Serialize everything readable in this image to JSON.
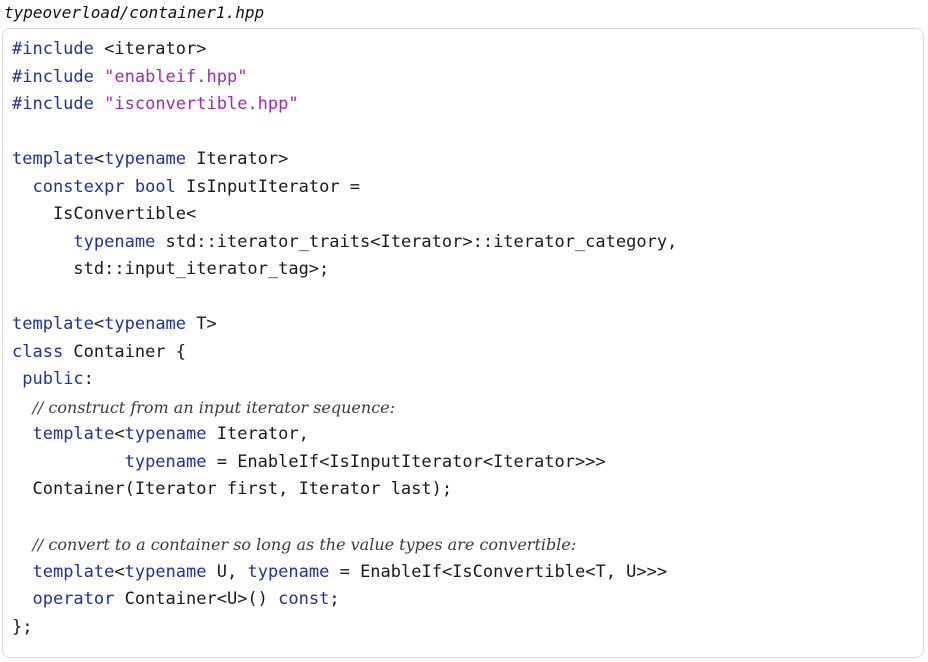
{
  "file": {
    "name": "typeoverload/container1.hpp"
  },
  "code": {
    "lines": [
      [
        {
          "t": "pp",
          "v": "#include"
        },
        {
          "t": "plain",
          "v": " <iterator>"
        }
      ],
      [
        {
          "t": "pp",
          "v": "#include"
        },
        {
          "t": "plain",
          "v": " "
        },
        {
          "t": "str",
          "v": "\"enableif.hpp\""
        }
      ],
      [
        {
          "t": "pp",
          "v": "#include"
        },
        {
          "t": "plain",
          "v": " "
        },
        {
          "t": "str",
          "v": "\"isconvertible.hpp\""
        }
      ],
      [],
      [
        {
          "t": "kw",
          "v": "template"
        },
        {
          "t": "plain",
          "v": "<"
        },
        {
          "t": "kw",
          "v": "typename"
        },
        {
          "t": "plain",
          "v": " Iterator>"
        }
      ],
      [
        {
          "t": "plain",
          "v": "  "
        },
        {
          "t": "kw",
          "v": "constexpr"
        },
        {
          "t": "plain",
          "v": " "
        },
        {
          "t": "kw",
          "v": "bool"
        },
        {
          "t": "plain",
          "v": " IsInputIterator ="
        }
      ],
      [
        {
          "t": "plain",
          "v": "    IsConvertible<"
        }
      ],
      [
        {
          "t": "plain",
          "v": "      "
        },
        {
          "t": "kw",
          "v": "typename"
        },
        {
          "t": "plain",
          "v": " std::iterator_traits<Iterator>::iterator_category,"
        }
      ],
      [
        {
          "t": "plain",
          "v": "      std::input_iterator_tag>;"
        }
      ],
      [],
      [
        {
          "t": "kw",
          "v": "template"
        },
        {
          "t": "plain",
          "v": "<"
        },
        {
          "t": "kw",
          "v": "typename"
        },
        {
          "t": "plain",
          "v": " T>"
        }
      ],
      [
        {
          "t": "kw",
          "v": "class"
        },
        {
          "t": "plain",
          "v": " Container {"
        }
      ],
      [
        {
          "t": "plain",
          "v": " "
        },
        {
          "t": "kw",
          "v": "public"
        },
        {
          "t": "plain",
          "v": ":"
        }
      ],
      [
        {
          "t": "plain",
          "v": "  "
        },
        {
          "t": "cm",
          "v": "// construct from an input iterator sequence:"
        }
      ],
      [
        {
          "t": "plain",
          "v": "  "
        },
        {
          "t": "kw",
          "v": "template"
        },
        {
          "t": "plain",
          "v": "<"
        },
        {
          "t": "kw",
          "v": "typename"
        },
        {
          "t": "plain",
          "v": " Iterator,"
        }
      ],
      [
        {
          "t": "plain",
          "v": "           "
        },
        {
          "t": "kw",
          "v": "typename"
        },
        {
          "t": "plain",
          "v": " = EnableIf<IsInputIterator<Iterator>>>"
        }
      ],
      [
        {
          "t": "plain",
          "v": "  Container(Iterator first, Iterator last);"
        }
      ],
      [],
      [
        {
          "t": "plain",
          "v": "  "
        },
        {
          "t": "cm",
          "v": "// convert to a container so long as the value types are convertible:"
        }
      ],
      [
        {
          "t": "plain",
          "v": "  "
        },
        {
          "t": "kw",
          "v": "template"
        },
        {
          "t": "plain",
          "v": "<"
        },
        {
          "t": "kw",
          "v": "typename"
        },
        {
          "t": "plain",
          "v": " U, "
        },
        {
          "t": "kw",
          "v": "typename"
        },
        {
          "t": "plain",
          "v": " = EnableIf<IsConvertible<T, U>>>"
        }
      ],
      [
        {
          "t": "plain",
          "v": "  "
        },
        {
          "t": "kw",
          "v": "operator"
        },
        {
          "t": "plain",
          "v": " Container<U>() "
        },
        {
          "t": "kw",
          "v": "const"
        },
        {
          "t": "plain",
          "v": ";"
        }
      ],
      [
        {
          "t": "plain",
          "v": "};"
        }
      ]
    ]
  }
}
